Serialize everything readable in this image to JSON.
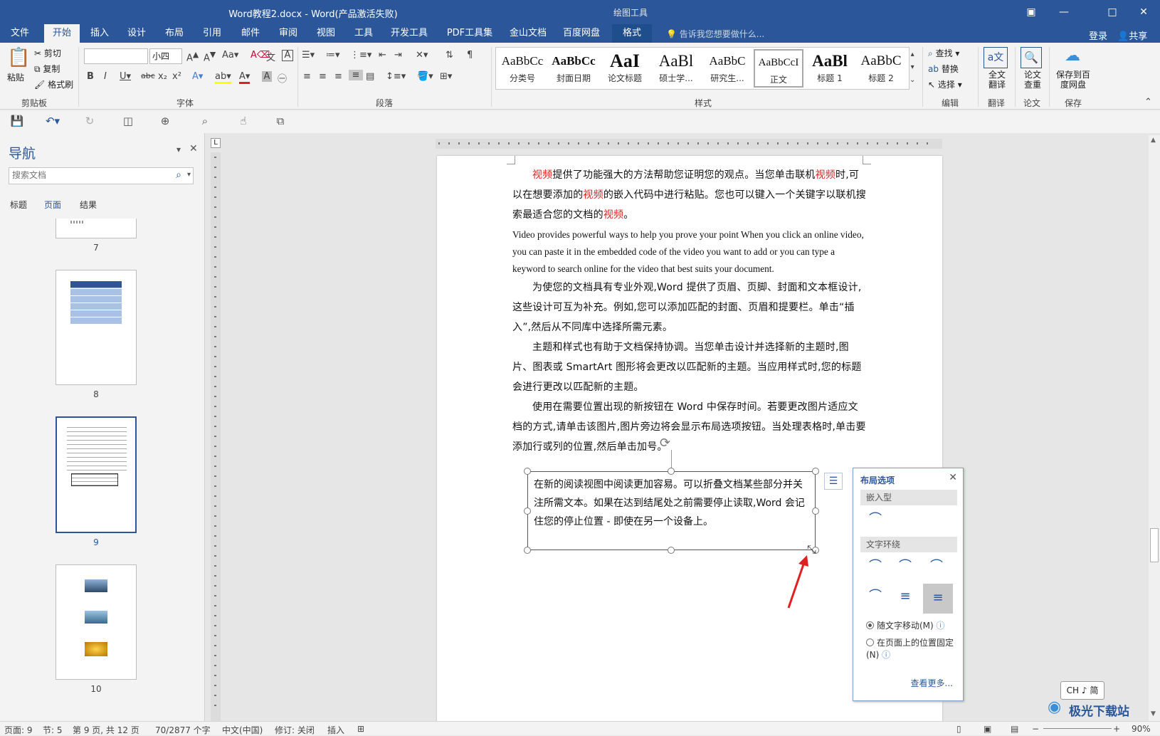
{
  "title_bar": {
    "document_title": "Word教程2.docx - Word(产品激活失败)",
    "context_tool": "绘图工具"
  },
  "tabs": [
    "文件",
    "开始",
    "插入",
    "设计",
    "布局",
    "引用",
    "邮件",
    "审阅",
    "视图",
    "工具",
    "开发工具",
    "PDF工具集",
    "金山文档",
    "百度网盘",
    "格式"
  ],
  "active_tab": "开始",
  "tell_me": "告诉我您想要做什么...",
  "account": {
    "login": "登录",
    "share": "共享"
  },
  "ribbon": {
    "clipboard": {
      "paste": "粘贴",
      "cut": "剪切",
      "copy": "复制",
      "format_painter": "格式刷",
      "label": "剪贴板"
    },
    "font": {
      "size": "小四",
      "label": "字体"
    },
    "paragraph": {
      "label": "段落"
    },
    "styles": {
      "label": "样式",
      "items": [
        {
          "sample": "AaBbCc",
          "name": "分类号"
        },
        {
          "sample": "AaBbCc",
          "name": "封面日期"
        },
        {
          "sample": "AaI",
          "name": "论文标题"
        },
        {
          "sample": "AaBl",
          "name": "硕士学..."
        },
        {
          "sample": "AaBbC",
          "name": "研究生..."
        },
        {
          "sample": "AaBbCcI",
          "name": "正文"
        },
        {
          "sample": "AaBl",
          "name": "标题 1"
        },
        {
          "sample": "AaBbC",
          "name": "标题 2"
        }
      ],
      "selected": "正文"
    },
    "editing": {
      "find": "查找",
      "replace": "替换",
      "select": "选择",
      "label": "编辑"
    },
    "translate": {
      "button": "全文翻译",
      "label": "翻译"
    },
    "paper": {
      "button": "论文查重",
      "label": "论文"
    },
    "save": {
      "button": "保存到百度网盘",
      "label": "保存"
    }
  },
  "nav": {
    "title": "导航",
    "search_placeholder": "搜索文档",
    "tabs": [
      "标题",
      "页面",
      "结果"
    ],
    "active_tab": "页面",
    "pages": [
      "7",
      "8",
      "9",
      "10"
    ],
    "selected_page": "9"
  },
  "document": {
    "p1": [
      "视频",
      "提供了功能强大的方法帮助您证明您的观点。当您单击联机",
      "视频",
      "时,可以在想要添加的",
      "视频",
      "的嵌入代码中进行粘贴。您也可以键入一个关键字以联机搜索最适合您的文档的",
      "视频",
      "。"
    ],
    "p2": "Video provides powerful ways to help you prove your point When you click an online video, you can paste it in the embedded code of the video you want to add or you can type a keyword to search online for the video that best suits your document.",
    "p3": "为使您的文档具有专业外观,Word 提供了页眉、页脚、封面和文本框设计,这些设计可互为补充。例如,您可以添加匹配的封面、页眉和提要栏。单击“插入”,然后从不同库中选择所需元素。",
    "p4": "主题和样式也有助于文档保持协调。当您单击设计并选择新的主题时,图片、图表或 SmartArt 图形将会更改以匹配新的主题。当应用样式时,您的标题会进行更改以匹配新的主题。",
    "p5": "使用在需要位置出现的新按钮在 Word 中保存时间。若要更改图片适应文档的方式,请单击该图片,图片旁边将会显示布局选项按钮。当处理表格时,单击要添加行或列的位置,然后单击加号。",
    "textbox": "在新的阅读视图中阅读更加容易。可以折叠文档某些部分并关注所需文本。如果在达到结尾处之前需要停止读取,Word 会记住您的停止位置 - 即使在另一个设备上。"
  },
  "layout_options": {
    "title": "布局选项",
    "inline_section": "嵌入型",
    "wrap_section": "文字环绕",
    "radio_move": "随文字移动(M)",
    "radio_fixed": "在页面上的位置固定(N)",
    "more": "查看更多..."
  },
  "ime": "CH ♪ 简",
  "watermark": "极光下载站",
  "status": {
    "page": "页面: 9",
    "section": "节: 5",
    "page_of": "第 9 页, 共 12 页",
    "words": "70/2877 个字",
    "language": "中文(中国)",
    "track": "修订: 关闭",
    "insert": "插入",
    "zoom": "90%"
  },
  "colors": {
    "accent": "#2b579a",
    "highlight_text": "#e02020",
    "arrow": "#e02020"
  }
}
